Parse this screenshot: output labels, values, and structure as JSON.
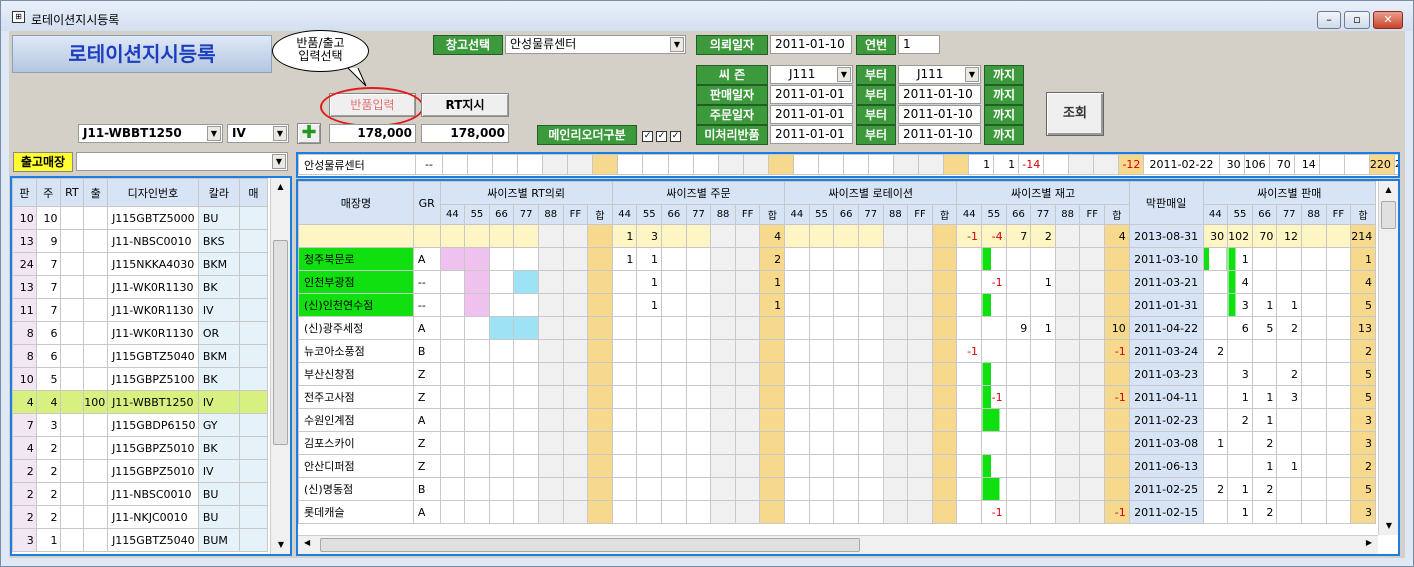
{
  "window": {
    "title": "로테이션지시등록"
  },
  "header": {
    "banner": "로테이션지시등록",
    "callout_line1": "반품/출고",
    "callout_line2": "입력선택",
    "return_input_btn": "반품입력",
    "rt_btn": "RT지시",
    "search_btn": "조회"
  },
  "filters": {
    "warehouse_label": "창고선택",
    "warehouse_value": "안성물류센터",
    "request_date_label": "의뢰일자",
    "request_date": "2011-01-10",
    "serial_label": "연번",
    "serial": "1",
    "season_label": "씨  즌",
    "season_from": "J111",
    "season_to": "J111",
    "sale_date_label": "판매일자",
    "sale_from": "2011-01-01",
    "sale_to": "2011-01-10",
    "order_date_label": "주문일자",
    "order_from": "2011-01-01",
    "order_to": "2011-01-10",
    "unprocessed_label": "미처리반품",
    "unp_from": "2011-01-01",
    "unp_to": "2011-01-10",
    "from": "부터",
    "to": "까지",
    "design_value": "J11-WBBT1250",
    "color_value": "IV",
    "amount1": "178,000",
    "amount2": "178,000",
    "main_order_label": "메인리오더구분",
    "store_label": "출고매장"
  },
  "left": {
    "headers": [
      "판",
      "주",
      "RT",
      "출",
      "디자인번호",
      "칼라",
      "매"
    ],
    "rows": [
      [
        "10",
        "10",
        "",
        "",
        "J115GBTZ5000",
        "BU",
        ""
      ],
      [
        "13",
        "9",
        "",
        "",
        "J11-NBSC0010",
        "BKS",
        ""
      ],
      [
        "24",
        "7",
        "",
        "",
        "J115NKKA4030",
        "BKM",
        ""
      ],
      [
        "13",
        "7",
        "",
        "",
        "J11-WK0R1130",
        "BK",
        ""
      ],
      [
        "11",
        "7",
        "",
        "",
        "J11-WK0R1130",
        "IV",
        ""
      ],
      [
        "8",
        "6",
        "",
        "",
        "J11-WK0R1130",
        "OR",
        ""
      ],
      [
        "8",
        "6",
        "",
        "",
        "J115GBTZ5040",
        "BKM",
        ""
      ],
      [
        "10",
        "5",
        "",
        "",
        "J115GBPZ5100",
        "BK",
        ""
      ],
      [
        "4",
        "4",
        "",
        "100",
        "J11-WBBT1250",
        "IV",
        ""
      ],
      [
        "7",
        "3",
        "",
        "",
        "J115GBDP6150",
        "GY",
        ""
      ],
      [
        "4",
        "2",
        "",
        "",
        "J115GBPZ5010",
        "BK",
        ""
      ],
      [
        "2",
        "2",
        "",
        "",
        "J115GBPZ5010",
        "IV",
        ""
      ],
      [
        "2",
        "2",
        "",
        "",
        "J11-NBSC0010",
        "BU",
        ""
      ],
      [
        "2",
        "2",
        "",
        "",
        "J11-NKJC0010",
        "BU",
        ""
      ],
      [
        "3",
        "1",
        "",
        "",
        "J115GBTZ5040",
        "BUM",
        ""
      ]
    ]
  },
  "right": {
    "wh_row": {
      "name": "안성물류센터",
      "gr": "--",
      "s_stock": [
        "1",
        "1",
        "-14",
        "",
        ""
      ],
      "stock_total": "-12",
      "last_date": "2011-02-22",
      "sales": [
        "30",
        "106",
        "70",
        "14",
        ""
      ],
      "sales_total": "220",
      "tail": "2("
    },
    "groups": [
      "싸이즈별 RT의뢰",
      "싸이즈별 주문",
      "싸이즈별 로테이션",
      "싸이즈별 재고",
      "싸이즈별 판매"
    ],
    "col_store": "매장명",
    "col_gr": "GR",
    "col_last": "막판매일",
    "sizes": [
      "44",
      "55",
      "66",
      "77",
      "88",
      "FF",
      "합"
    ],
    "total": {
      "order": [
        "1",
        "3",
        "",
        "",
        "",
        "",
        "4"
      ],
      "stock": [
        "-1",
        "-4",
        "7",
        "2",
        "",
        "",
        "4"
      ],
      "last": "2013-08-31",
      "sales": [
        "30",
        "102",
        "70",
        "12",
        "",
        "",
        "214"
      ]
    },
    "rows": [
      {
        "name": "청주북문로",
        "gr": "A",
        "order": [
          "1",
          "1",
          "",
          "",
          "",
          "",
          "2"
        ],
        "stock": [
          "",
          "",
          "",
          "",
          "",
          "",
          ""
        ],
        "last": "2011-03-10",
        "sales": [
          "",
          "1",
          "",
          "",
          "",
          "",
          "1"
        ],
        "hl": true
      },
      {
        "name": "인천부광점",
        "gr": "--",
        "order": [
          "",
          "1",
          "",
          "",
          "",
          "",
          "1"
        ],
        "stock": [
          "",
          "-1",
          "",
          "1",
          "",
          "",
          ""
        ],
        "last": "2011-03-21",
        "sales": [
          "",
          "4",
          "",
          "",
          "",
          "",
          "4"
        ],
        "hl": true
      },
      {
        "name": "(신)인천연수점",
        "gr": "--",
        "order": [
          "",
          "1",
          "",
          "",
          "",
          "",
          "1"
        ],
        "stock": [
          "",
          "",
          "",
          "",
          "",
          "",
          ""
        ],
        "last": "2011-01-31",
        "sales": [
          "",
          "3",
          "1",
          "1",
          "",
          "",
          "5"
        ],
        "hl": true
      },
      {
        "name": "(신)광주세정",
        "gr": "A",
        "order": [
          "",
          "",
          "",
          "",
          "",
          "",
          ""
        ],
        "stock": [
          "",
          "",
          "9",
          "1",
          "",
          "",
          "10"
        ],
        "last": "2011-04-22",
        "sales": [
          "",
          "6",
          "5",
          "2",
          "",
          "",
          "13"
        ]
      },
      {
        "name": "뉴코아소풍점",
        "gr": "B",
        "order": [
          "",
          "",
          "",
          "",
          "",
          "",
          ""
        ],
        "stock": [
          "-1",
          "",
          "",
          "",
          "",
          "",
          "-1"
        ],
        "last": "2011-03-24",
        "sales": [
          "2",
          "",
          "",
          "",
          "",
          "",
          "2"
        ]
      },
      {
        "name": "부산신창점",
        "gr": "Z",
        "order": [
          "",
          "",
          "",
          "",
          "",
          "",
          ""
        ],
        "stock": [
          "",
          "",
          "",
          "",
          "",
          "",
          ""
        ],
        "last": "2011-03-23",
        "sales": [
          "",
          "3",
          "",
          "2",
          "",
          "",
          "5"
        ]
      },
      {
        "name": "전주고사점",
        "gr": "Z",
        "order": [
          "",
          "",
          "",
          "",
          "",
          "",
          ""
        ],
        "stock": [
          "",
          "-1",
          "",
          "",
          "",
          "",
          "-1"
        ],
        "last": "2011-04-11",
        "sales": [
          "",
          "1",
          "1",
          "3",
          "",
          "",
          "5"
        ]
      },
      {
        "name": "수원인계점",
        "gr": "A",
        "order": [
          "",
          "",
          "",
          "",
          "",
          "",
          ""
        ],
        "stock": [
          "",
          "",
          "",
          "",
          "",
          "",
          ""
        ],
        "last": "2011-02-23",
        "sales": [
          "",
          "2",
          "1",
          "",
          "",
          "",
          "3"
        ]
      },
      {
        "name": "김포스카이",
        "gr": "Z",
        "order": [
          "",
          "",
          "",
          "",
          "",
          "",
          ""
        ],
        "stock": [
          "",
          "",
          "",
          "",
          "",
          "",
          ""
        ],
        "last": "2011-03-08",
        "sales": [
          "1",
          "",
          "2",
          "",
          "",
          "",
          "3"
        ]
      },
      {
        "name": "안산디퍼점",
        "gr": "Z",
        "order": [
          "",
          "",
          "",
          "",
          "",
          "",
          ""
        ],
        "stock": [
          "",
          "",
          "",
          "",
          "",
          "",
          ""
        ],
        "last": "2011-06-13",
        "sales": [
          "",
          "",
          "1",
          "1",
          "",
          "",
          "2"
        ]
      },
      {
        "name": "(신)명동점",
        "gr": "B",
        "order": [
          "",
          "",
          "",
          "",
          "",
          "",
          ""
        ],
        "stock": [
          "",
          "",
          "",
          "",
          "",
          "",
          ""
        ],
        "last": "2011-02-25",
        "sales": [
          "2",
          "1",
          "2",
          "",
          "",
          "",
          "5"
        ]
      },
      {
        "name": "롯데캐슬",
        "gr": "A",
        "order": [
          "",
          "",
          "",
          "",
          "",
          "",
          ""
        ],
        "stock": [
          "",
          "-1",
          "",
          "",
          "",
          "",
          "-1"
        ],
        "last": "2011-02-15",
        "sales": [
          "",
          "1",
          "2",
          "",
          "",
          "",
          "3"
        ]
      }
    ]
  }
}
